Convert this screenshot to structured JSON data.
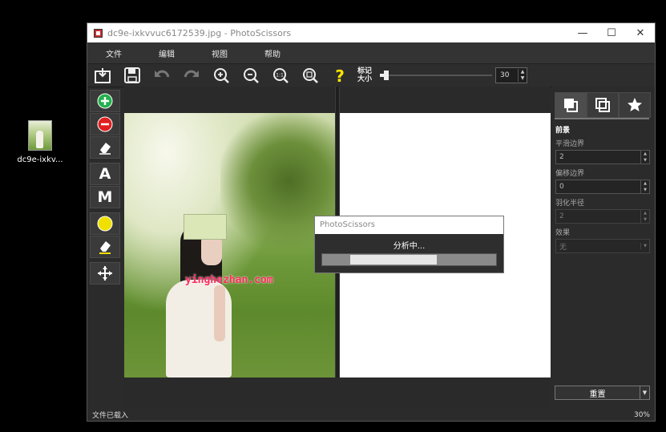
{
  "desktop": {
    "icon_label": "dc9e-ixkv..."
  },
  "window": {
    "title": "dc9e-ixkvvuc6172539.jpg - PhotoScissors",
    "controls": {
      "minimize": "—",
      "maximize": "☐",
      "close": "✕"
    }
  },
  "menu": [
    "文件",
    "编辑",
    "视图",
    "帮助"
  ],
  "toolbar": {
    "mark_size_label": "标记大小",
    "mark_size_value": "30",
    "mark_size_fraction": 0.06
  },
  "tools": {
    "letter_a": "A",
    "letter_m": "M"
  },
  "image": {
    "watermark": "yinghezhan.com"
  },
  "dialog": {
    "title": "PhotoScissors",
    "message": "分析中...",
    "progress_start": 0.16,
    "progress_end": 0.66
  },
  "right_panel": {
    "section": "前景",
    "fields": [
      {
        "label": "平滑边界",
        "value": "2"
      },
      {
        "label": "偏移边界",
        "value": "0"
      },
      {
        "label": "羽化半径",
        "value": "2"
      }
    ],
    "effect_label": "效果",
    "effect_value": "无",
    "reset_label": "重置"
  },
  "status": {
    "left": "文件已载入",
    "right": "30%"
  },
  "colors": {
    "add": "#22b14c",
    "remove": "#e02020",
    "marker": "#f0e000",
    "help": "#ffe400"
  }
}
